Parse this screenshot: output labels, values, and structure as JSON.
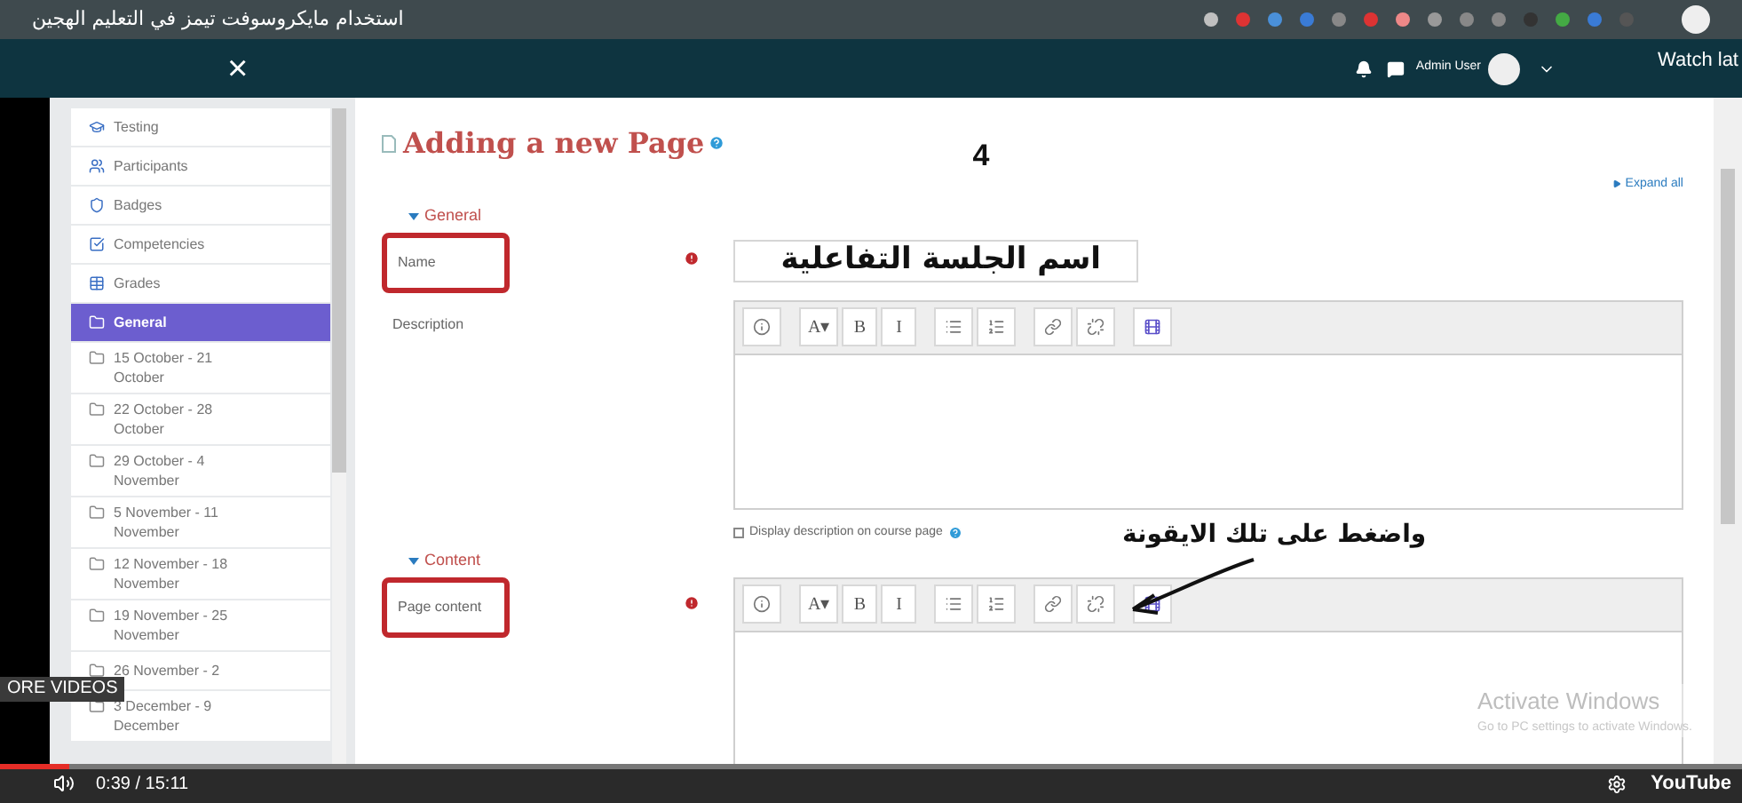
{
  "video": {
    "title": "استخدام مايكروسوفت تيمز في التعليم الهجين",
    "watch_later": "Watch lat",
    "more_videos": "ORE VIDEOS",
    "time": "0:39 / 15:11",
    "brand": "YouTube",
    "progress": {
      "level": 0.04
    }
  },
  "navbar": {
    "close": "×",
    "user": "Admin User"
  },
  "sidebar": {
    "items": [
      {
        "label": "Testing",
        "kind": "course",
        "selected": false
      },
      {
        "label": "Participants",
        "kind": "people",
        "selected": false
      },
      {
        "label": "Badges",
        "kind": "badge",
        "selected": false
      },
      {
        "label": "Competencies",
        "kind": "competency",
        "selected": false
      },
      {
        "label": "Grades",
        "kind": "grades",
        "selected": false
      },
      {
        "label": "General",
        "kind": "section",
        "selected": true
      },
      {
        "label": "15 October - 21",
        "label2": "October",
        "kind": "section",
        "selected": false
      },
      {
        "label": "22 October - 28",
        "label2": "October",
        "kind": "section",
        "selected": false
      },
      {
        "label": "29 October - 4",
        "label2": "November",
        "kind": "section",
        "selected": false
      },
      {
        "label": "5 November - 11",
        "label2": "November",
        "kind": "section",
        "selected": false
      },
      {
        "label": "12 November - 18",
        "label2": "November",
        "kind": "section",
        "selected": false
      },
      {
        "label": "19 November - 25",
        "label2": "November",
        "kind": "section",
        "selected": false
      },
      {
        "label": "26 November - 2",
        "kind": "section",
        "selected": false
      },
      {
        "label": "3 December - 9",
        "label2": "December",
        "kind": "section",
        "selected": false
      }
    ]
  },
  "page": {
    "title": "Adding a new Page",
    "step": "4",
    "expand_all": "Expand all",
    "sections": [
      {
        "header": "General",
        "expanded": true,
        "fields": [
          {
            "label": "Name",
            "kind": "text",
            "required": true,
            "highlighted": true,
            "value": "اسم الجلسة التفاعلية"
          },
          {
            "label": "Description",
            "kind": "editor",
            "required": false,
            "highlighted": false,
            "toolbar": [
              {
                "kind": "info"
              },
              {
                "kind": "text",
                "label": "A▾"
              },
              {
                "kind": "text",
                "label": "B"
              },
              {
                "kind": "text",
                "label": "I"
              },
              {
                "kind": "bullets"
              },
              {
                "kind": "numbers"
              },
              {
                "kind": "link"
              },
              {
                "kind": "unlink"
              },
              {
                "kind": "media"
              }
            ]
          }
        ],
        "checkbox": {
          "label": "Display description on course page",
          "checked": false
        }
      },
      {
        "header": "Content",
        "expanded": true,
        "fields": [
          {
            "label": "Page content",
            "kind": "editor",
            "required": true,
            "highlighted": true,
            "toolbar": [
              {
                "kind": "info"
              },
              {
                "kind": "text",
                "label": "A▾"
              },
              {
                "kind": "text",
                "label": "B"
              },
              {
                "kind": "text",
                "label": "I"
              },
              {
                "kind": "bullets"
              },
              {
                "kind": "numbers"
              },
              {
                "kind": "link"
              },
              {
                "kind": "unlink"
              },
              {
                "kind": "media"
              }
            ]
          }
        ]
      }
    ],
    "annotation": "واضغط على تلك الايقونة"
  },
  "windows_notice": {
    "title": "Activate Windows",
    "text": "Go to PC settings to activate Windows."
  }
}
